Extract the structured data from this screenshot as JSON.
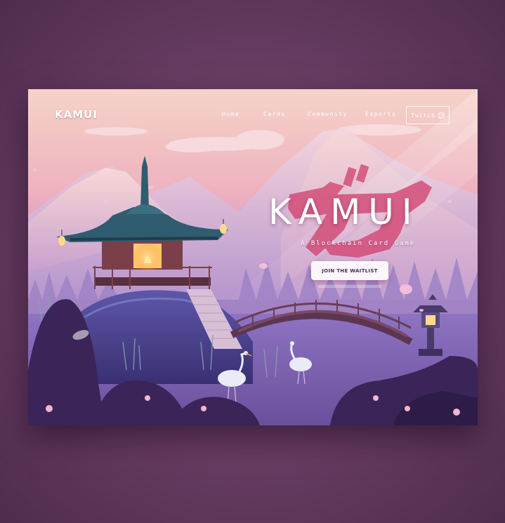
{
  "brand": {
    "logo_text": "KAMUI"
  },
  "nav": {
    "links": [
      {
        "label": "Home"
      },
      {
        "label": "Cards"
      },
      {
        "label": "Community"
      },
      {
        "label": "Esports"
      }
    ],
    "twitch_label": "Twitch"
  },
  "hero": {
    "title": "KAMUI",
    "kanji_mark": "ガ",
    "subtitle": "A Blockchain Card Game",
    "cta_label": "JOIN THE WAITLIST"
  },
  "icons": {
    "twitch": "twitch-icon",
    "lantern": "lantern-icon"
  },
  "colors": {
    "page_background": "#6b3f66",
    "sky_top": "#f4c9c6",
    "sky_mid": "#e6a3c0",
    "kanji_mark": "#d23e6c",
    "cta_background": "#fbf6fb",
    "cta_text": "#4a2f4f"
  }
}
